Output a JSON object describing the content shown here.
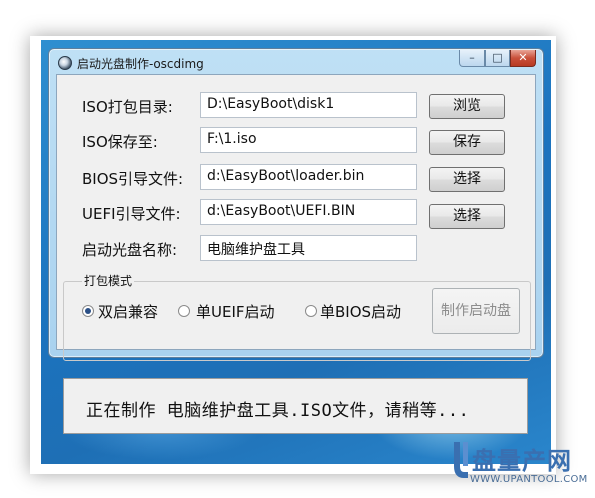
{
  "window": {
    "title": "启动光盘制作-oscdimg",
    "min_glyph": "–",
    "max_glyph": "□",
    "close_glyph": "✕"
  },
  "form": {
    "iso_dir_label": "ISO打包目录:",
    "iso_dir_value": "D:\\EasyBoot\\disk1",
    "browse_label": "浏览",
    "iso_save_label": "ISO保存至:",
    "iso_save_value": "F:\\1.iso",
    "save_label": "保存",
    "bios_label": "BIOS引导文件:",
    "bios_value": "d:\\EasyBoot\\loader.bin",
    "bios_select_label": "选择",
    "uefi_label": "UEFI引导文件:",
    "uefi_value": "d:\\EasyBoot\\UEFI.BIN",
    "uefi_select_label": "选择",
    "disc_name_label": "启动光盘名称:",
    "disc_name_value": "电脑维护盘工具"
  },
  "pack_mode": {
    "group_title": "打包模式",
    "options": [
      {
        "label": "双启兼容",
        "selected": true
      },
      {
        "label": "单UEIF启动",
        "selected": false
      },
      {
        "label": "单BIOS启动",
        "selected": false
      }
    ],
    "make_button_label": "制作启动盘",
    "make_button_enabled": false
  },
  "status": {
    "text": "正在制作 电脑维护盘工具.ISO文件，请稍等..."
  },
  "watermark": {
    "brand": "盘量产网",
    "url": "WWW.UPANTOOL.COM"
  },
  "colors": {
    "desktop": "#1b73bf",
    "window_frame": "#a9d2ef",
    "close_button": "#c9503a",
    "watermark": "#3a6fb0"
  }
}
